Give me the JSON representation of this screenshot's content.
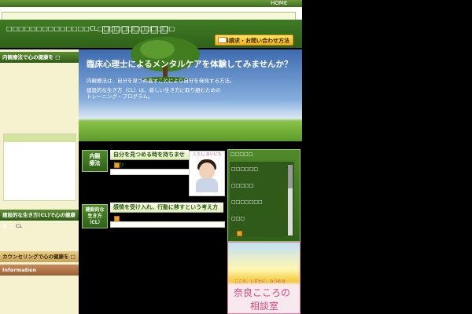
{
  "header": {
    "home_link": "HOME",
    "tagline": "□□□□□□□□□□□□□□CL□□□□□□□□□□□□□",
    "site_title": "□□□□□□□",
    "contact_button": "資料請求・お問い合わせ方法"
  },
  "sidebar": {
    "section1": "内観療法で心の健康を □",
    "section2": "建設的な生き方(CL)で心の健康を □",
    "section2_item": "CL",
    "section3": "カウンセリングで心の健康を □",
    "section4": "Information"
  },
  "hero": {
    "title": "臨床心理士によるメンタルケアを体験してみませんか？",
    "line1": "内観療法は、自分を見つめ直すことにより自分を発見する方法。",
    "line2": "建設的な生き方（CL）は、新しい生き方に取り組むための",
    "line3": "トレーニング・プログラム。"
  },
  "sections": [
    {
      "badge_top": "内観",
      "badge_bottom": "療法",
      "title": "自分を見つめる時を持ちませんか"
    },
    {
      "badge_top": "建設的な",
      "badge_mid": "生き方",
      "badge_bottom": "（CL）",
      "title": "感情を受け入れ、行動に移すという考え方"
    }
  ],
  "photo_caption": "くらし まいにち",
  "news": {
    "title": "□□□□□",
    "items": [
      "□□□□□□",
      "□□□□□",
      "□□□□□□□",
      "□□□"
    ]
  },
  "ad": {
    "small": "こころ、しずかに、みつめる",
    "big1": "奈良こころの",
    "big2": "相談室"
  }
}
